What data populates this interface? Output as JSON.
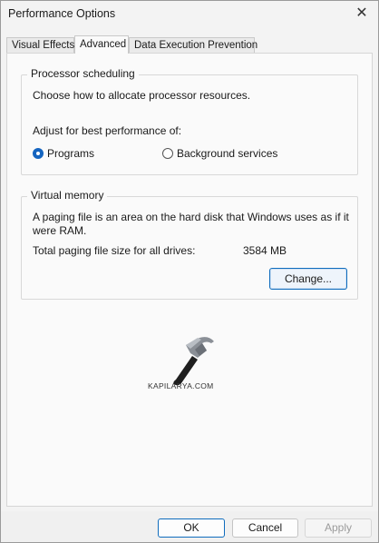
{
  "window": {
    "title": "Performance Options",
    "close_symbol": "✕"
  },
  "tabs": [
    {
      "label": "Visual Effects"
    },
    {
      "label": "Advanced"
    },
    {
      "label": "Data Execution Prevention"
    }
  ],
  "processor_scheduling": {
    "heading": "Processor scheduling",
    "description": "Choose how to allocate processor resources.",
    "adjust_label": "Adjust for best performance of:",
    "option_programs": "Programs",
    "option_background": "Background services",
    "selected": "Programs"
  },
  "virtual_memory": {
    "heading": "Virtual memory",
    "description_line1": "A paging file is an area on the hard disk that Windows uses as if it",
    "description_line2": "were RAM.",
    "total_label": "Total paging file size for all drives:",
    "total_value": "3584 MB",
    "change_button": "Change..."
  },
  "watermark": {
    "text": "KAPILARYA.COM",
    "icon": "hammer-icon"
  },
  "footer": {
    "ok": "OK",
    "cancel": "Cancel",
    "apply": "Apply"
  },
  "colors": {
    "accent": "#0f6cbd",
    "radio_selected": "#1565c0"
  }
}
